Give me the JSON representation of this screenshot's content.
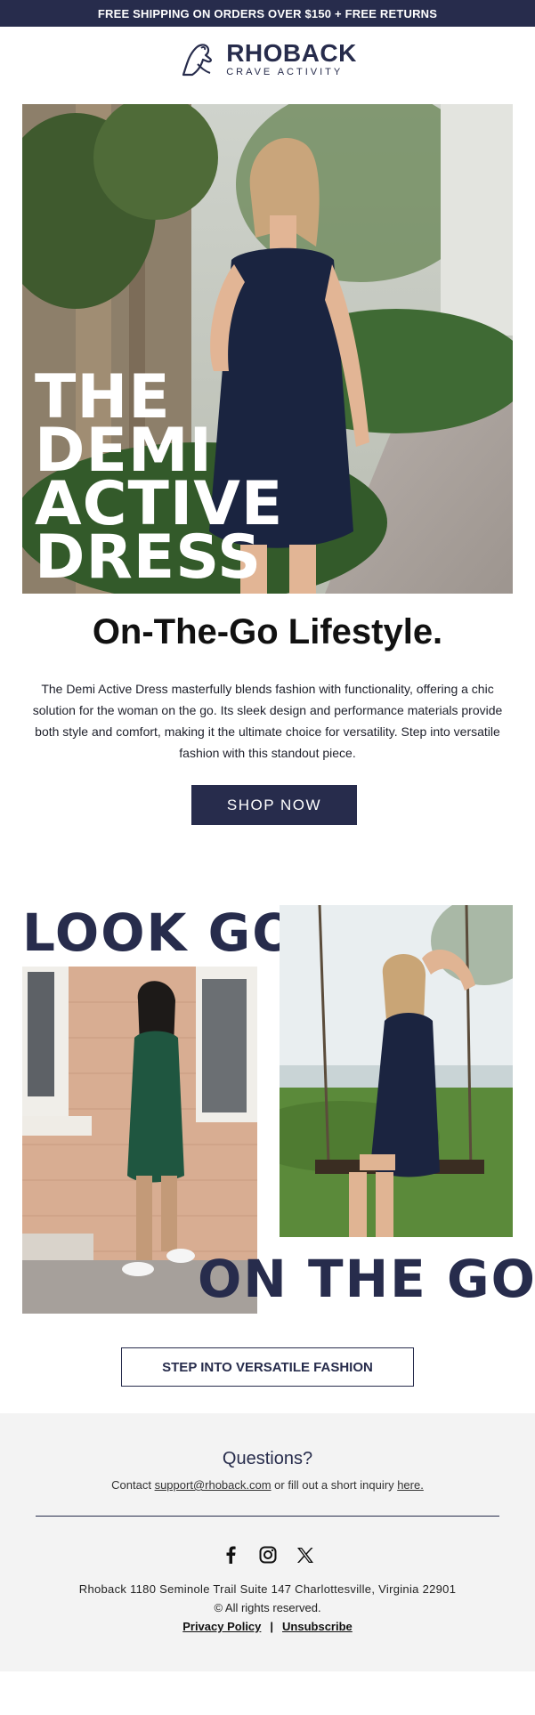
{
  "announcement": {
    "text": "FREE SHIPPING ON ORDERS OVER $150 + FREE RETURNS"
  },
  "logo": {
    "brand": "RHOBACK",
    "tagline": "CRAVE ACTIVITY",
    "icon": "dog-logo-icon"
  },
  "hero": {
    "title_lines": [
      "THE",
      "DEMI",
      "ACTIVE",
      "DRESS"
    ],
    "image": "woman-in-navy-dress-photo"
  },
  "headline": "On-The-Go Lifestyle.",
  "body_copy": "The Demi Active Dress masterfully blends fashion with functionality, offering a chic solution for the woman on the go. Its sleek design and performance materials provide both style and comfort, making it the ultimate choice for versatility. Step into versatile fashion with this standout piece.",
  "shop_button": "SHOP NOW",
  "collage": {
    "look_good": "LOOK GOOD",
    "on_the_go": "ON THE GO",
    "left_image": "woman-in-green-dress-walking-photo",
    "right_image": "woman-in-navy-dress-on-swing-photo"
  },
  "cta_outline": "STEP INTO VERSATILE FASHION",
  "footer": {
    "questions_title": "Questions?",
    "contact_prefix": "Contact ",
    "contact_email": "support@rhoback.com",
    "contact_middle": " or fill out a short inquiry ",
    "contact_link": "here.",
    "social": [
      "facebook-icon",
      "instagram-icon",
      "x-icon"
    ],
    "address": "Rhoback 1180 Seminole Trail Suite 147 Charlottesville, Virginia 22901",
    "rights": "© All rights reserved.",
    "privacy": "Privacy Policy",
    "separator": "|",
    "unsubscribe": "Unsubscribe"
  },
  "colors": {
    "navy": "#272c4c",
    "footer_bg": "#f3f3f3",
    "white": "#ffffff"
  }
}
